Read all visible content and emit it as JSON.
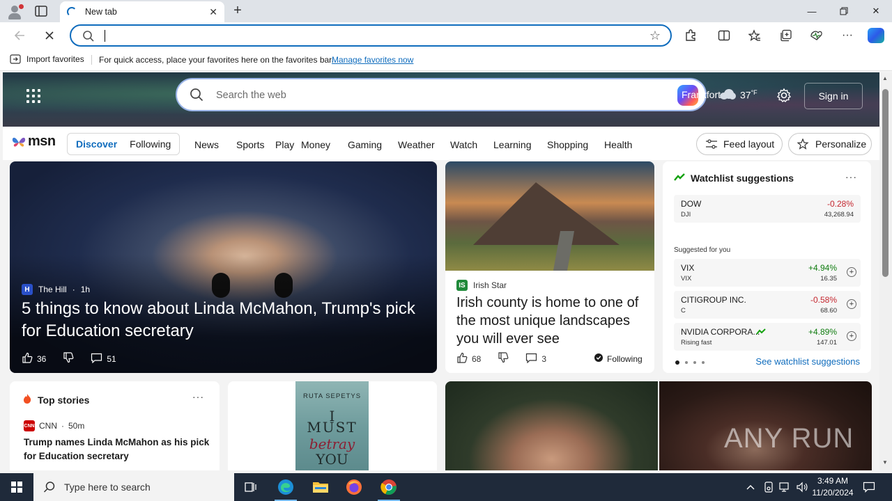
{
  "browser": {
    "tab_title": "New tab",
    "address_value": "",
    "favbar": {
      "import_label": "Import favorites",
      "hint": "For quick access, place your favorites here on the favorites bar.",
      "manage_link": "Manage favorites now"
    }
  },
  "msn": {
    "search_placeholder": "Search the web",
    "weather": {
      "city": "Frankfort",
      "temp": "37",
      "unit": "°F"
    },
    "signin_label": "Sign in",
    "logo_text": "msn",
    "feed_tabs": {
      "active": "Discover",
      "other": "Following"
    },
    "nav_links": [
      "News",
      "Sports",
      "Play",
      "Money",
      "Gaming",
      "Weather",
      "Watch",
      "Learning",
      "Shopping",
      "Health"
    ],
    "feed_layout_label": "Feed layout",
    "personalize_label": "Personalize"
  },
  "hero_story": {
    "source": "The Hill",
    "age": "1h",
    "title": "5 things to know about Linda McMahon, Trump's pick for Education secretary",
    "likes": "36",
    "comments": "51"
  },
  "irish_story": {
    "source": "Irish Star",
    "title": "Irish county is home to one of the most unique landscapes you will ever see",
    "likes": "68",
    "comments": "3",
    "follow_label": "Following"
  },
  "watchlist": {
    "title": "Watchlist suggestions",
    "primary": {
      "name": "DOW",
      "ticker": "DJI",
      "change": "-0.28%",
      "price": "43,268.94"
    },
    "suggested_label": "Suggested for you",
    "suggestions": [
      {
        "name": "VIX",
        "ticker": "VIX",
        "change": "+4.94%",
        "price": "16.35",
        "direction": "up"
      },
      {
        "name": "CITIGROUP INC.",
        "ticker": "C",
        "change": "-0.58%",
        "price": "68.60",
        "direction": "down"
      },
      {
        "name": "NVIDIA CORPORA...",
        "ticker": "Rising fast",
        "change": "+4.89%",
        "price": "147.01",
        "direction": "up"
      }
    ],
    "see_more": "See watchlist suggestions"
  },
  "top_stories": {
    "title": "Top stories",
    "source": "CNN",
    "age": "50m",
    "headline": "Trump names Linda McMahon as his pick for Education secretary"
  },
  "book": {
    "author": "RUTA SEPETYS",
    "line1": "I",
    "line2": "MUST",
    "line3": "betray",
    "line4": "YOU"
  },
  "watermark": "ANY RUN",
  "taskbar": {
    "search_placeholder": "Type here to search",
    "time": "3:49 AM",
    "date": "11/20/2024"
  },
  "colors": {
    "accent": "#0f6cbd",
    "negative": "#c4262e",
    "positive": "#107c10"
  }
}
